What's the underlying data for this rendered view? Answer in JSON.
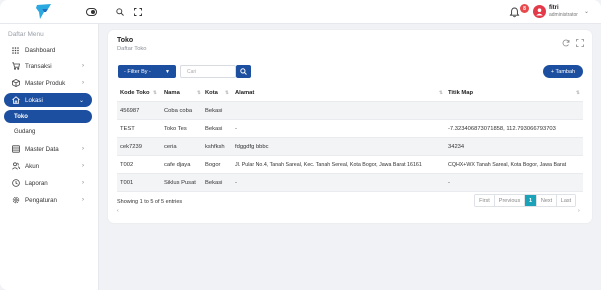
{
  "topbar": {
    "user_name": "fitri",
    "user_role": "administrator",
    "notif_count": "8"
  },
  "sidebar": {
    "title": "Daftar Menu",
    "items": [
      {
        "label": "Dashboard",
        "icon": "dashboard-icon"
      },
      {
        "label": "Transaksi",
        "icon": "cart-icon"
      },
      {
        "label": "Master Produk",
        "icon": "box-icon"
      },
      {
        "label": "Lokasi",
        "icon": "home-icon"
      },
      {
        "label": "Master Data",
        "icon": "database-icon"
      },
      {
        "label": "Akun",
        "icon": "users-icon"
      },
      {
        "label": "Laporan",
        "icon": "clock-icon"
      },
      {
        "label": "Pengaturan",
        "icon": "gear-icon"
      }
    ],
    "sub_items": [
      {
        "label": "Toko"
      },
      {
        "label": "Gudang"
      }
    ]
  },
  "page": {
    "title": "Toko",
    "subtitle": "Daftar Toko",
    "filter_label": "- Filter By -",
    "search_placeholder": "Cari",
    "add_label": "+ Tambah"
  },
  "table": {
    "headers": [
      "Kode Toko",
      "Nama",
      "Kota",
      "Alamat",
      "Titik Map"
    ],
    "rows": [
      [
        "456987",
        "Coba coba",
        "Bekasi",
        "",
        ""
      ],
      [
        "TEST",
        "Toko Tes",
        "Bekasi",
        "-",
        "-7.3234068730718​58, 112.7930667937​03"
      ],
      [
        "cek7239",
        "ceria",
        "kshfksh",
        "fdggdfg bbbc",
        "34234"
      ],
      [
        "T002",
        "cafe djaya",
        "Bogor",
        "Jl. Pular No.4, Tanah Sareal, Kec. Tanah Sereal, Kota Bogor, Jawa Barat 16161",
        "CQHX+WX Tanah Sareal, Kota Bogor, Jawa Barat"
      ],
      [
        "T001",
        "Siklus Pusat",
        "Bekasi",
        "-",
        "-"
      ]
    ]
  },
  "footer": {
    "info": "Showing 1 to 5 of 5 entries",
    "pager": [
      "First",
      "Previous",
      "1",
      "Next",
      "Last"
    ]
  },
  "colors": {
    "primary": "#1d4fa0",
    "page_active": "#1aa3b8",
    "badge": "#e8494b",
    "avatar": "#e23a49"
  }
}
